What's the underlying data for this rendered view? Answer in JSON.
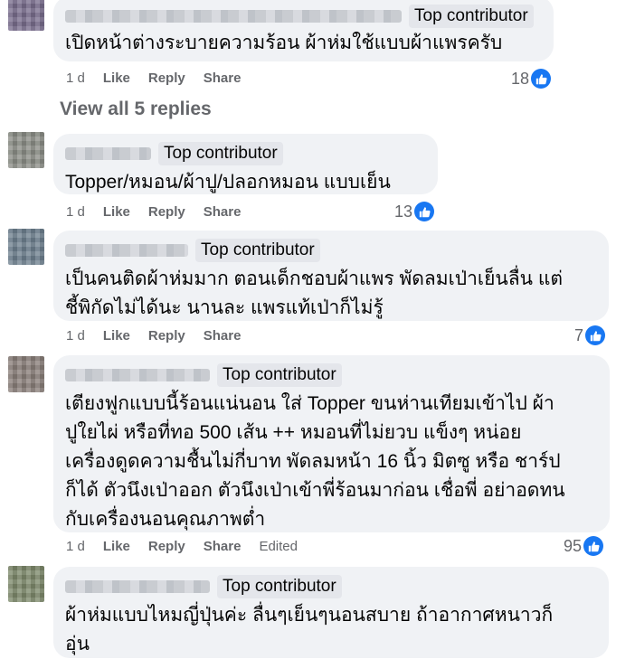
{
  "comments": [
    {
      "badge": "Top contributor",
      "text": "เปิดหน้าต่างระบายความร้อน ผ้าห่มใช้แบบผ้าแพรครับ",
      "time": "1 d",
      "like": "Like",
      "reply": "Reply",
      "share": "Share",
      "count": "18"
    },
    {
      "badge": "Top contributor",
      "text": "Topper/หมอน/ผ้าปู/ปลอกหมอน แบบเย็น",
      "time": "1 d",
      "like": "Like",
      "reply": "Reply",
      "share": "Share",
      "count": "13"
    },
    {
      "badge": "Top contributor",
      "text": "เป็นคนติดผ้าห่มมาก ตอนเด็กชอบผ้าแพร พัดลมเป่าเย็นลื่น แต่\nชี้พิกัดไม่ได้นะ นานละ แพรแท้เป่าก็ไม่รู้",
      "time": "1 d",
      "like": "Like",
      "reply": "Reply",
      "share": "Share",
      "count": "7"
    },
    {
      "badge": "Top contributor",
      "text": "เตียงฟูกแบบนี้ร้อนแน่นอน ใส่ Topper ขนห่านเทียมเข้าไป ผ้า\nปูใยไผ่ หรือที่ทอ 500 เส้น ++ หมอนที่ไม่ยวบ แข็งๆ หน่อย\nเครื่องดูดความชื้นไม่กี่บาท พัดลมหน้า 16 นิ้ว มิตซู หรือ ชาร์ป\nก็ได้ ตัวนึงเป่าออก ตัวนึงเป่าเข้าพี่ร้อนมาก่อน เชื่อพี่ อย่าอดทน\nกับเครื่องนอนคุณภาพต่ำ",
      "time": "1 d",
      "like": "Like",
      "reply": "Reply",
      "share": "Share",
      "edited": "Edited",
      "count": "95"
    },
    {
      "badge": "Top contributor",
      "text": "ผ้าห่มแบบไหมญี่ปุ่นค่ะ ลื่นๆเย็นๆนอนสบาย ถ้าอากาศหนาวก็\nอุ่น"
    }
  ],
  "view_replies": "View all 5 replies",
  "colors": {
    "bubble": "#f0f2f5",
    "like_blue": "#1877f2",
    "meta": "#65676b"
  },
  "icons": {
    "like": "thumbs-up-icon"
  }
}
